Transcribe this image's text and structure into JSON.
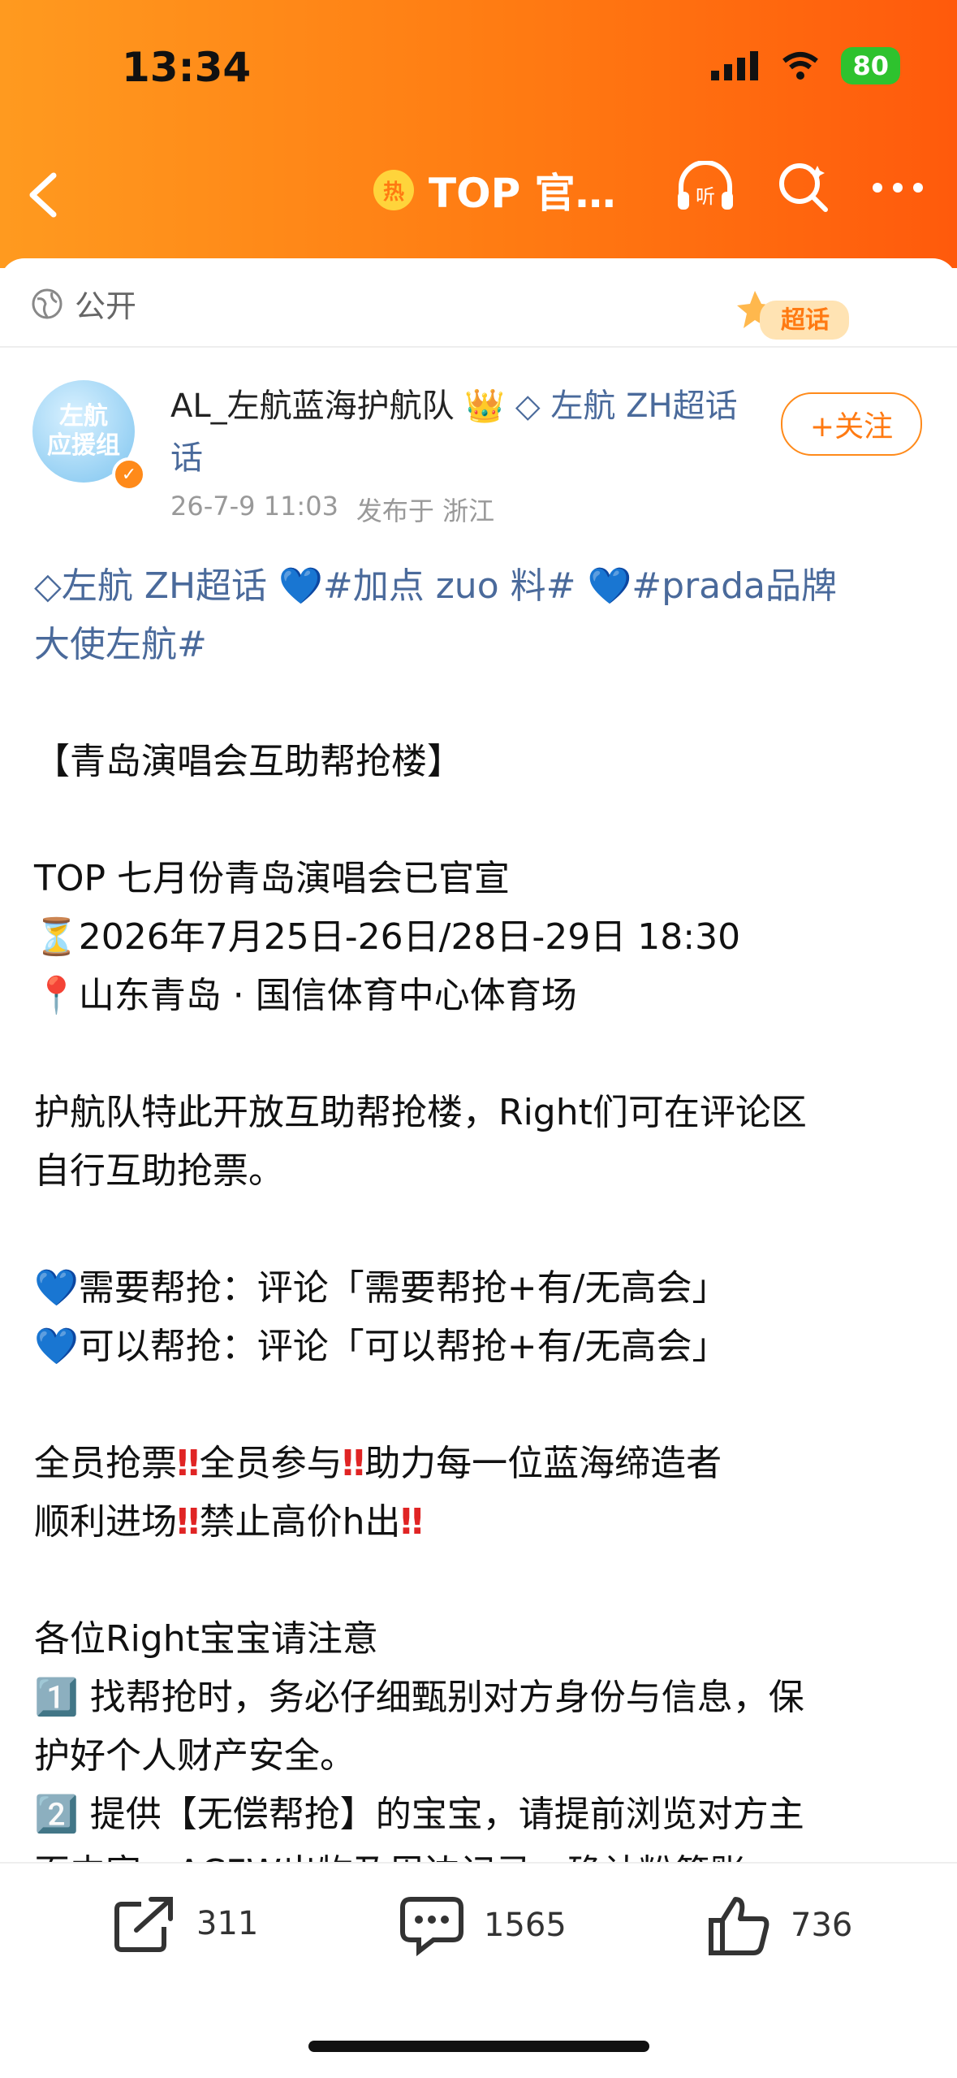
{
  "status_bar": {
    "time": "13:34",
    "battery": "80"
  },
  "nav": {
    "hot_badge": "热",
    "title": "TOP 官…"
  },
  "post": {
    "privacy": "公开",
    "chaohua_badge": "超话",
    "avatar_text": "左航\n应援组",
    "username": "AL_左航蓝海护航队",
    "super_topic": "左航 ZH超话",
    "username_wrap": "话",
    "date": "26-7-9 11:03",
    "location": "发布于 浙江",
    "follow_label": "+关注"
  },
  "content": {
    "tags_line1_a": "左航 ZH超话",
    "tags_line1_b": "#加点 zuo 料#",
    "tags_line1_c": "#prada品牌",
    "tags_line2": "大使左航#",
    "title": "【青岛演唱会互助帮抢楼】",
    "announce": "TOP 七月份青岛演唱会已官宣",
    "time_line": "2026年7月25日-26日/28日-29日 18:30",
    "venue_line": "山东青岛 · 国信体育中心体育场",
    "para1_l1": "护航队特此开放互助帮抢楼，Right们可在评论区",
    "para1_l2": "自行互助抢票。",
    "need_line": "需要帮抢：评论「需要帮抢+有/无高会」",
    "can_line": "可以帮抢：评论「可以帮抢+有/无高会」",
    "rules_a": "全员抢票",
    "rules_b": "全员参与",
    "rules_c": "助力每一位蓝海缔造者",
    "rules_d": "顺利进场",
    "rules_e": "禁止高价h出",
    "notice_title": "各位Right宝宝请注意",
    "note1_l1": "找帮抢时，务必仔细甄别对方身份与信息，保",
    "note1_l2": "护好个人财产安全。",
    "note2_l1": "提供【无偿帮抢】的宝宝，请提前浏览对方主",
    "note2_l2": "页内容，ACFW出物及周边记录，确认粉籍账"
  },
  "actions": {
    "repost": "311",
    "comment": "1565",
    "like": "736"
  }
}
